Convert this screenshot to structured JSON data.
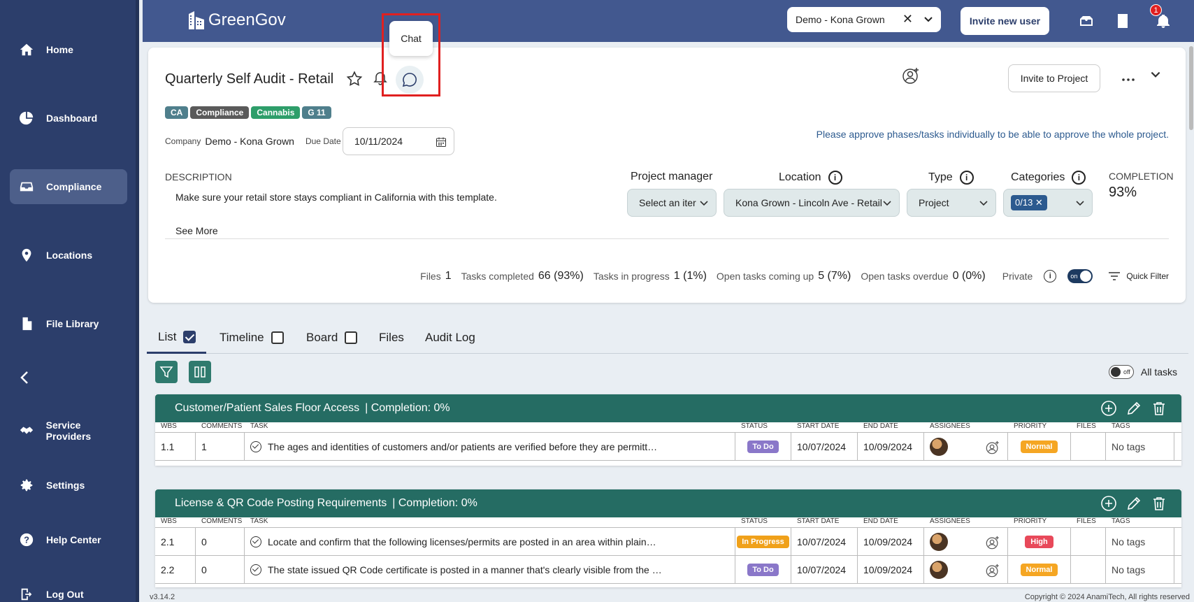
{
  "sidebar": {
    "items": [
      {
        "label": "Home",
        "icon": "home-icon"
      },
      {
        "label": "Dashboard",
        "icon": "pie-chart-icon"
      },
      {
        "label": "Compliance",
        "icon": "inbox-icon"
      },
      {
        "label": "Locations",
        "icon": "map-pin-icon"
      },
      {
        "label": "File Library",
        "icon": "file-icon"
      },
      {
        "label": "Service Providers",
        "icon": "handshake-icon"
      },
      {
        "label": "Settings",
        "icon": "gear-icon"
      },
      {
        "label": "Help Center",
        "icon": "help-icon"
      },
      {
        "label": "Log Out",
        "icon": "logout-icon"
      }
    ],
    "active": "Compliance"
  },
  "topbar": {
    "logo_text": "GreenGov",
    "company_selected": "Demo - Kona Grown",
    "invite_label": "Invite new user",
    "notification_count": "1"
  },
  "project": {
    "title": "Quarterly Self Audit - Retail",
    "chat_tooltip": "Chat",
    "tags": [
      {
        "label": "CA",
        "color": "#4f7f8c"
      },
      {
        "label": "Compliance",
        "color": "#5a5a5a"
      },
      {
        "label": "Cannabis",
        "color": "#2e9e6a"
      },
      {
        "label": "G 11",
        "color": "#4f7f8c"
      }
    ],
    "company_label": "Company",
    "company_value": "Demo - Kona Grown",
    "due_date_label": "Due Date",
    "due_date_value": "10/11/2024",
    "approve_note": "Please approve phases/tasks individually to be able to approve the whole project.",
    "invite_project_label": "Invite to Project",
    "description_label": "DESCRIPTION",
    "description_text": "Make sure your retail store stays compliant in California with this template.",
    "see_more": "See More",
    "fields": {
      "project_manager_label": "Project manager",
      "project_manager_value": "Select an iter",
      "location_label": "Location",
      "location_value": "Kona Grown - Lincoln Ave - Retail",
      "type_label": "Type",
      "type_value": "Project",
      "categories_label": "Categories",
      "categories_value": "0/13"
    },
    "completion_label": "COMPLETION",
    "completion_value": "93%",
    "stats": {
      "files_label": "Files",
      "files_value": "1",
      "completed_label": "Tasks completed",
      "completed_value": "66 (93%)",
      "in_progress_label": "Tasks in progress",
      "in_progress_value": "1 (1%)",
      "coming_up_label": "Open tasks coming up",
      "coming_up_value": "5 (7%)",
      "overdue_label": "Open tasks overdue",
      "overdue_value": "0 (0%)",
      "private_label": "Private",
      "private_toggle": "on",
      "quick_filter": "Quick Filter"
    }
  },
  "tabs": [
    {
      "label": "List",
      "checkbox": true,
      "checked": true
    },
    {
      "label": "Timeline",
      "checkbox": true,
      "checked": false
    },
    {
      "label": "Board",
      "checkbox": true,
      "checked": false
    },
    {
      "label": "Files",
      "checkbox": false
    },
    {
      "label": "Audit Log",
      "checkbox": false
    }
  ],
  "all_tasks": {
    "toggle": "off",
    "label": "All tasks"
  },
  "columns": [
    "WBS",
    "COMMENTS",
    "TASK",
    "STATUS",
    "START DATE",
    "END DATE",
    "ASSIGNEES",
    "PRIORITY",
    "FILES",
    "TAGS"
  ],
  "groups": [
    {
      "title": "Customer/Patient Sales Floor Access",
      "completion": "| Completion: 0%",
      "rows": [
        {
          "wbs": "1.1",
          "comments": "1",
          "task": "The ages and identities of customers and/or patients are verified before they are permitt…",
          "status": "To Do",
          "start": "10/07/2024",
          "end": "10/09/2024",
          "priority": "Normal",
          "tags": "No tags"
        }
      ]
    },
    {
      "title": "License & QR Code Posting Requirements",
      "completion": "| Completion: 0%",
      "rows": [
        {
          "wbs": "2.1",
          "comments": "0",
          "task": "Locate and confirm that the following licenses/permits are posted in an area within plain…",
          "status": "In Progress",
          "start": "10/07/2024",
          "end": "10/09/2024",
          "priority": "High",
          "tags": "No tags"
        },
        {
          "wbs": "2.2",
          "comments": "0",
          "task": "The state issued QR Code certificate is posted in a manner that's clearly visible from the …",
          "status": "To Do",
          "start": "10/07/2024",
          "end": "10/09/2024",
          "priority": "Normal",
          "tags": "No tags"
        }
      ]
    }
  ],
  "status_colors": {
    "To Do": "#8a77c9",
    "In Progress": "#f0a11a"
  },
  "priority_colors": {
    "Normal": "#f5a623",
    "High": "#e8495a"
  },
  "footer": {
    "version": "v3.14.2",
    "copyright": "Copyright © 2024 AnamiTech, All rights reserved"
  }
}
